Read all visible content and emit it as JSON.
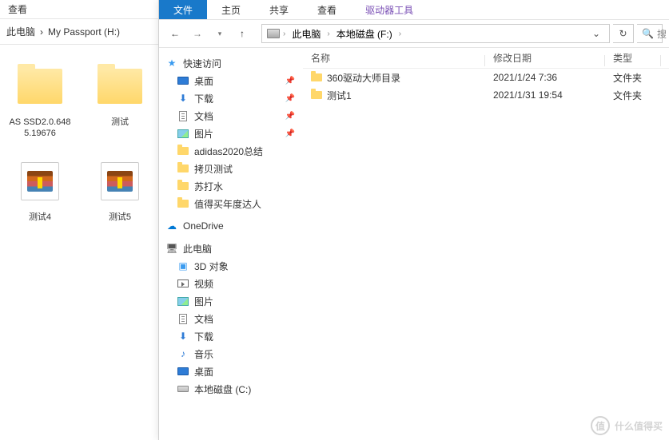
{
  "left_window": {
    "ribbon": {
      "view": "查看"
    },
    "breadcrumb": {
      "pc": "此电脑",
      "drive": "My Passport (H:)"
    },
    "items": [
      {
        "name": "AS SSD2.0.6485.19676",
        "kind": "folder"
      },
      {
        "name": "测试",
        "kind": "folder"
      },
      {
        "name": "测试4",
        "kind": "rar"
      },
      {
        "name": "测试5",
        "kind": "rar"
      }
    ]
  },
  "right_window": {
    "ribbon": {
      "file": "文件",
      "home": "主页",
      "share": "共享",
      "view": "查看",
      "drive_tools": "驱动器工具"
    },
    "breadcrumb": {
      "pc": "此电脑",
      "drive": "本地磁盘 (F:)"
    },
    "search_placeholder": "搜",
    "sidebar": {
      "quick_access": "快速访问",
      "desktop": "桌面",
      "downloads": "下载",
      "documents": "文档",
      "pictures": "图片",
      "adidas": "adidas2020总结",
      "copy_test": "拷贝测试",
      "soda": "苏打水",
      "zdm_expert": "值得买年度达人",
      "onedrive": "OneDrive",
      "this_pc": "此电脑",
      "objects_3d": "3D 对象",
      "videos": "视频",
      "pc_pictures": "图片",
      "pc_documents": "文档",
      "pc_downloads": "下载",
      "music": "音乐",
      "pc_desktop": "桌面",
      "local_disk_c": "本地磁盘 (C:)"
    },
    "columns": {
      "name": "名称",
      "date": "修改日期",
      "type": "类型"
    },
    "rows": [
      {
        "name": "360驱动大师目录",
        "date": "2021/1/24 7:36",
        "type": "文件夹"
      },
      {
        "name": "测试1",
        "date": "2021/1/31 19:54",
        "type": "文件夹"
      }
    ]
  },
  "watermark": {
    "char": "值",
    "text": "什么值得买"
  }
}
